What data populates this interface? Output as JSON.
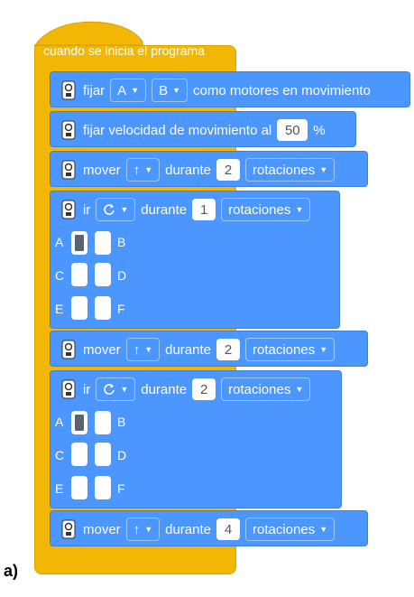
{
  "hat": {
    "label": "cuando se inicia el programa",
    "color": "#F2B705"
  },
  "block_color": "#4C97FF",
  "blocks": {
    "set_motors": {
      "label": "fijar",
      "port1": "A",
      "port2": "B",
      "suffix": "como motores en movimiento"
    },
    "set_speed": {
      "label": "fijar velocidad de movimiento al",
      "value": "50",
      "unit": "%"
    },
    "move1": {
      "label": "mover",
      "direction": "↑",
      "during": "durante",
      "value": "2",
      "unit": "rotaciones"
    },
    "go1": {
      "label": "ir",
      "during": "durante",
      "value": "1",
      "unit": "rotaciones",
      "grid": {
        "a": "A",
        "b": "B",
        "c": "C",
        "d": "D",
        "e": "E",
        "f": "F"
      }
    },
    "move2": {
      "label": "mover",
      "direction": "↑",
      "during": "durante",
      "value": "2",
      "unit": "rotaciones"
    },
    "go2": {
      "label": "ir",
      "during": "durante",
      "value": "2",
      "unit": "rotaciones",
      "grid": {
        "a": "A",
        "b": "B",
        "c": "C",
        "d": "D",
        "e": "E",
        "f": "F"
      }
    },
    "move3": {
      "label": "mover",
      "direction": "↑",
      "during": "durante",
      "value": "4",
      "unit": "rotaciones"
    }
  },
  "figure_label": "a)"
}
